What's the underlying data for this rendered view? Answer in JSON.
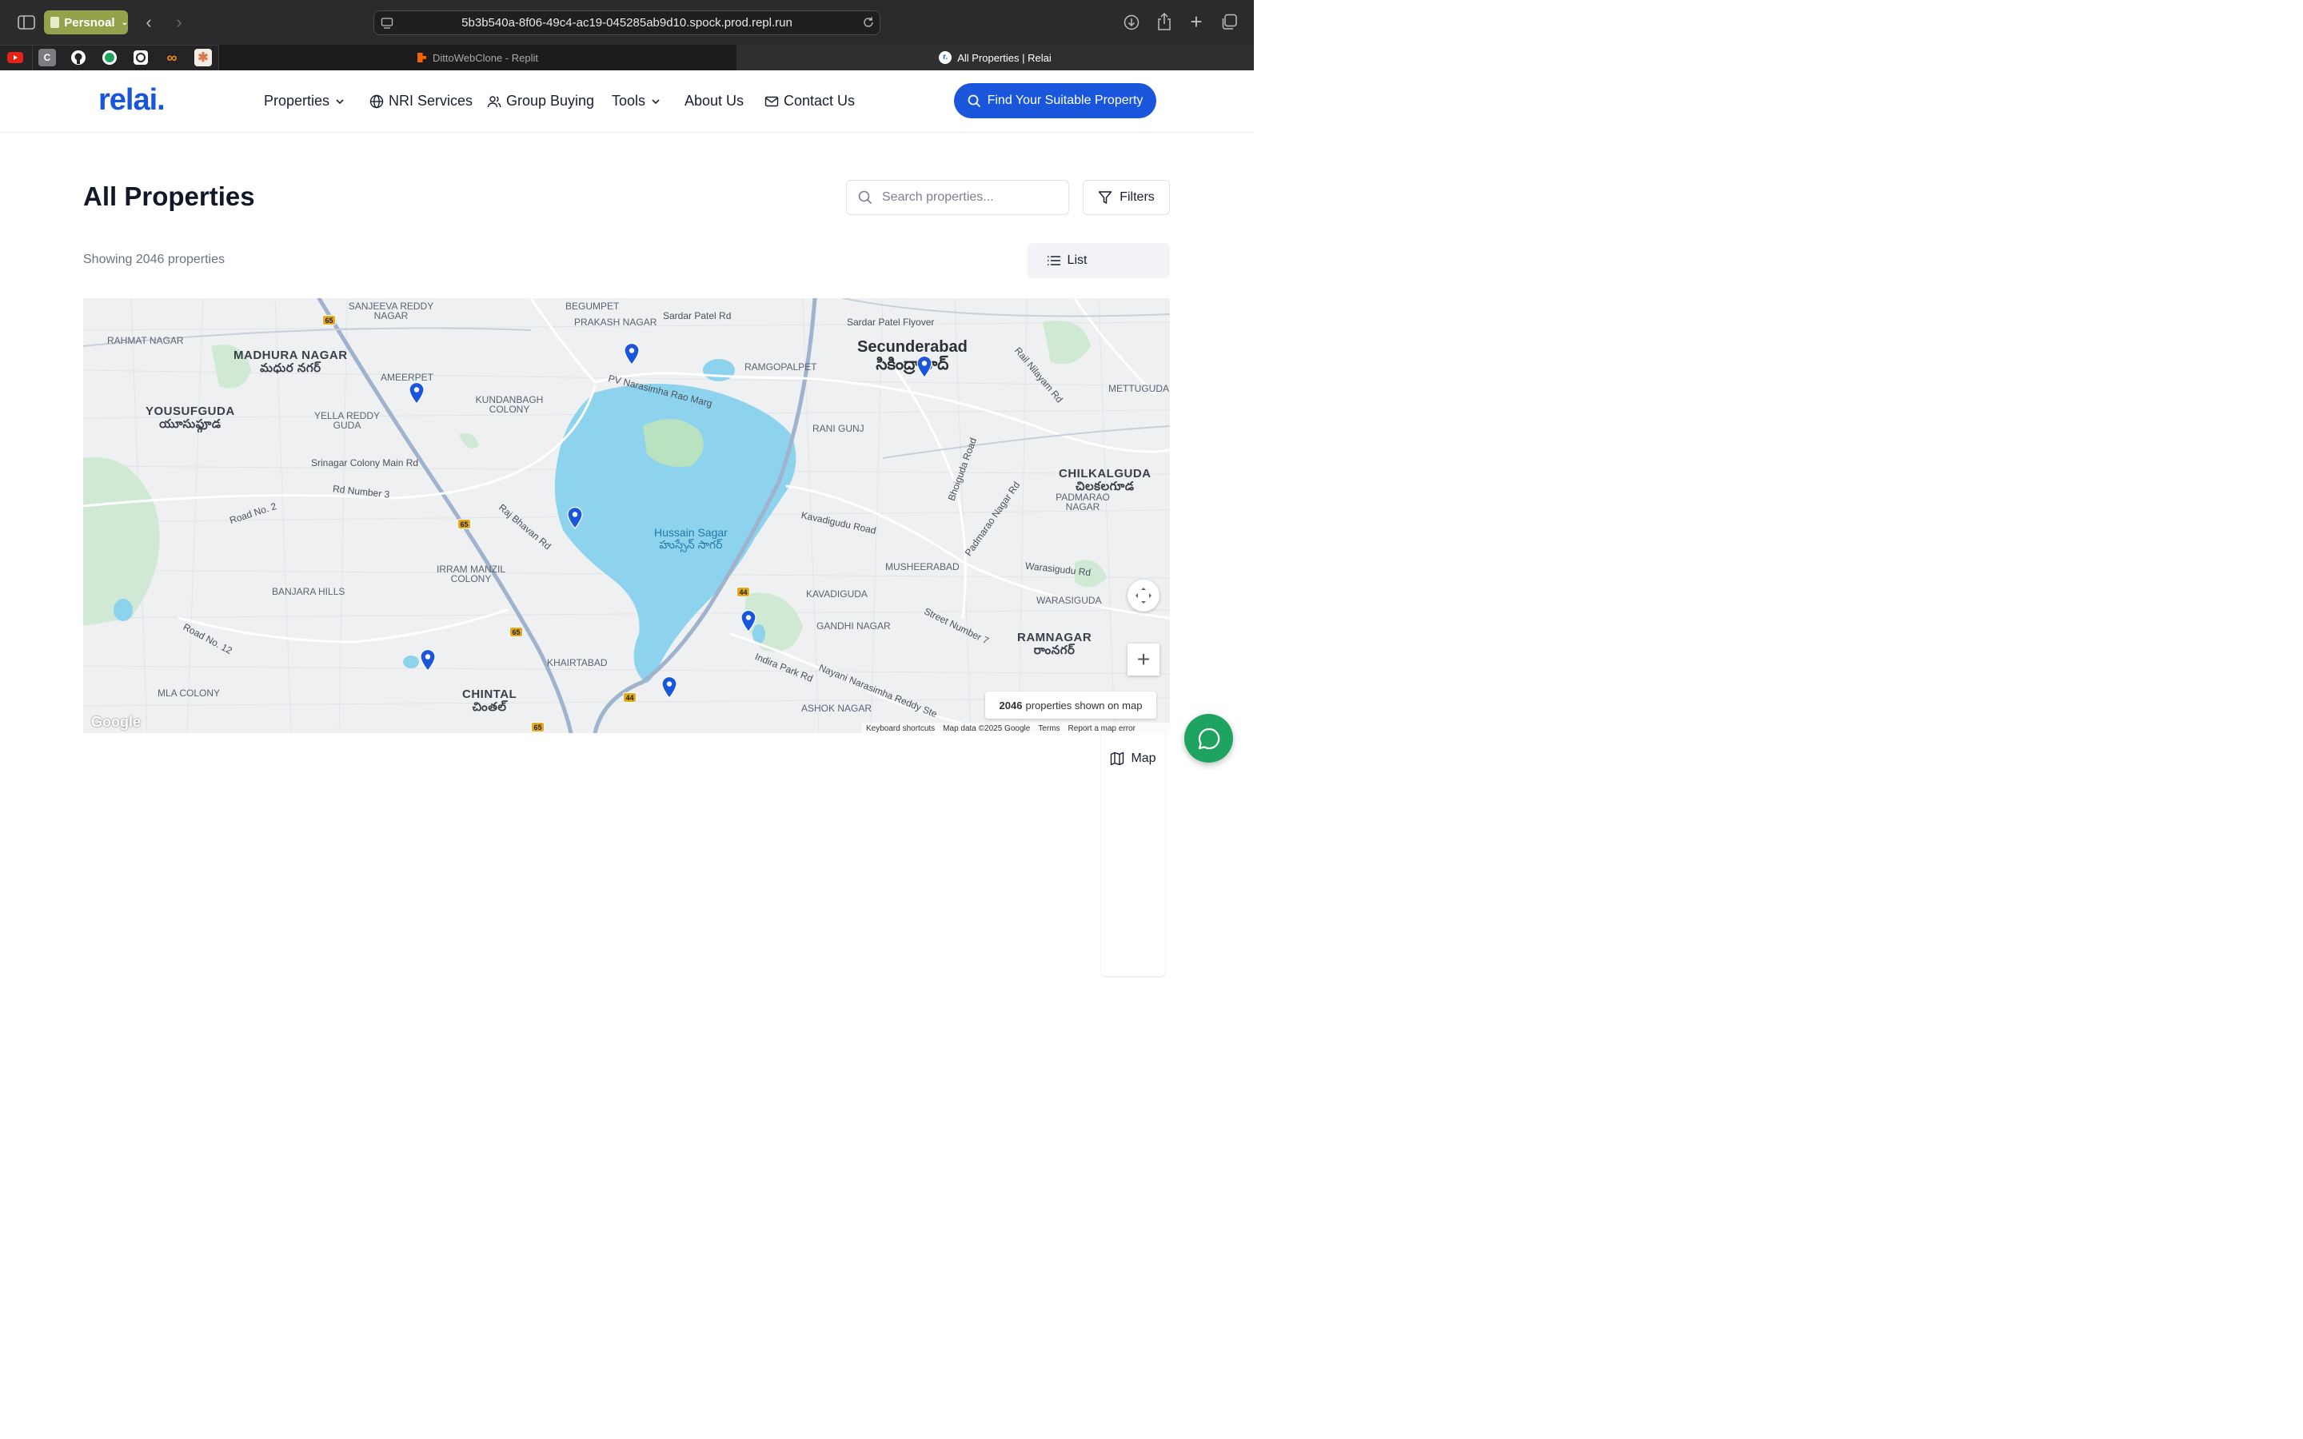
{
  "browser": {
    "profile_label": "Persnoal",
    "url": "5b3b540a-8f06-49c4-ac19-045285ab9d10.spock.prod.repl.run",
    "tabs": [
      {
        "title": "DittoWebClone - Replit",
        "active": false
      },
      {
        "title": "All Properties | Relai",
        "active": true
      }
    ],
    "favorites": [
      "youtube-icon",
      "c-app-icon",
      "github-icon",
      "whatsapp-icon",
      "chatgpt-icon",
      "infinity-icon",
      "claude-icon"
    ]
  },
  "header": {
    "logo": "relai.",
    "nav": [
      {
        "label": "Properties",
        "icon": "chevron-down-icon"
      },
      {
        "label": "NRI Services",
        "icon": "globe-icon"
      },
      {
        "label": "Group Buying",
        "icon": "users-icon"
      },
      {
        "label": "Tools",
        "icon": "chevron-down-icon"
      },
      {
        "label": "About Us",
        "icon": ""
      },
      {
        "label": "Contact Us",
        "icon": "mail-icon"
      }
    ],
    "cta_label": "Find Your Suitable Property"
  },
  "page": {
    "title": "All Properties",
    "search_placeholder": "Search properties...",
    "filters_label": "Filters",
    "count_text": "Showing 2046 properties",
    "view_toggle": {
      "list_label": "List",
      "map_label": "Map",
      "active": "Map"
    }
  },
  "map": {
    "areas": [
      {
        "en": "MADHURA NAGAR",
        "te": "మధుర నగర్"
      },
      {
        "en": "YOUSUFGUDA",
        "te": "యూసుఫ్గూడ"
      },
      {
        "en": "Secunderabad",
        "te": "సికింద్రాబాద్"
      },
      {
        "en": "CHILKALGUDA",
        "te": "చిలకలగూడ"
      },
      {
        "en": "CHINTAL",
        "te": "చింతల్"
      },
      {
        "en": "RAMNAGAR",
        "te": "రాంనగర్"
      }
    ],
    "small_labels": [
      "RAHMAT NAGAR",
      "SANJEEVA REDDY NAGAR",
      "BEGUMPET",
      "PRAKASH NAGAR",
      "AMEERPET",
      "KUNDANBAGH COLONY",
      "YELLA REDDY GUDA",
      "RAMGOPALPET",
      "RANI GUNJ",
      "METTUGUDA",
      "PADMARAO NAGAR",
      "BANJARA HILLS",
      "IRRAM MANZIL COLONY",
      "KHAIRTABAD",
      "KAVADIGUDA",
      "GANDHI NAGAR",
      "MUSHEERABAD",
      "WARASIGUDA",
      "ASHOK NAGAR",
      "MLA COLONY"
    ],
    "roads": [
      "Sardar Patel Rd",
      "Sardar Patel Flyover",
      "PV Narasimha Rao Marg",
      "Srinagar Colony Main Rd",
      "Rd Number 3",
      "Road No. 2",
      "Raj Bhavan Rd",
      "Kavadigudu Road",
      "Road No. 12",
      "Indira Park Rd",
      "Street Number 7",
      "Warasigudu Rd",
      "Rail Nilayam Rd",
      "Bhoiguda Road",
      "Padmarao Nagar Rd",
      "Nayani Narasimha Reddy Ste"
    ],
    "lake": {
      "en": "Hussain Sagar",
      "te": "హుస్సేన్ సాగర్"
    },
    "highways": [
      "65",
      "65",
      "65",
      "65",
      "44",
      "44",
      "65"
    ],
    "pins": 8,
    "info": {
      "count": "2046",
      "suffix": "properties shown on map"
    },
    "attribution": [
      "Keyboard shortcuts",
      "Map data ©2025 Google",
      "Terms",
      "Report a map error"
    ],
    "google_logo": "Google"
  },
  "colors": {
    "brand": "#1a56db",
    "chat": "#1ea361",
    "water": "#8ed3ee"
  }
}
